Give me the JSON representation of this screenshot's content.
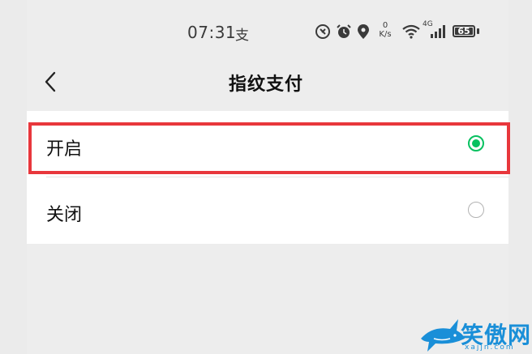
{
  "status_bar": {
    "time": "07:31",
    "pay_icon_text": "支",
    "net_speed_value": "0",
    "net_speed_unit": "K/s",
    "signal_label": "4G",
    "battery_level": "65",
    "icons": [
      "mute-icon",
      "alarm-icon",
      "location-icon",
      "wifi-icon",
      "signal-icon",
      "battery-icon"
    ]
  },
  "header": {
    "title": "指纹支付",
    "back_icon": "chevron-left-icon"
  },
  "options": [
    {
      "label": "开启",
      "selected": true
    },
    {
      "label": "关闭",
      "selected": false
    }
  ],
  "watermark": {
    "text": "笑傲网",
    "url": "xajjn.com"
  },
  "colors": {
    "background": "#ededed",
    "card": "#ffffff",
    "accent": "#07c160",
    "highlight": "#e8373c",
    "watermark": "#1a8fd8"
  }
}
